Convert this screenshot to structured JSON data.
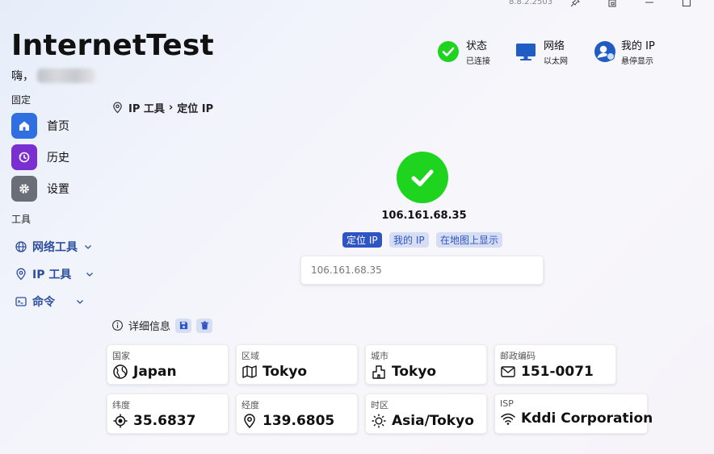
{
  "window": {
    "version": "8.8.2.2503"
  },
  "app": {
    "title": "InternetTest",
    "greeting": "嗨，"
  },
  "sidebar": {
    "pinned_label": "固定",
    "pinned": [
      {
        "label": "首页",
        "icon": "home-icon",
        "color": "#2f6fe0"
      },
      {
        "label": "历史",
        "icon": "history-icon",
        "color": "#7a2fd0"
      },
      {
        "label": "设置",
        "icon": "gear-icon",
        "color": "#6a6e76"
      }
    ],
    "tools_label": "工具",
    "tools": [
      {
        "label": "网络工具",
        "icon": "globe-icon"
      },
      {
        "label": "IP 工具",
        "icon": "location-pin-icon"
      },
      {
        "label": "命令",
        "icon": "terminal-icon"
      }
    ]
  },
  "status": {
    "state": {
      "title": "状态",
      "sub": "已连接",
      "icon": "check-circle-icon"
    },
    "network": {
      "title": "网络",
      "sub": "以太网",
      "icon": "monitor-icon"
    },
    "my_ip": {
      "title": "我的 IP",
      "sub": "悬停显示",
      "icon": "user-globe-icon"
    }
  },
  "breadcrumb": {
    "root": "IP 工具",
    "separator": "›",
    "current": "定位 IP"
  },
  "result": {
    "ip": "106.161.68.35"
  },
  "actions": {
    "locate": "定位 IP",
    "my_ip": "我的 IP",
    "map": "在地图上显示"
  },
  "input": {
    "value": "106.161.68.35"
  },
  "details": {
    "title": "详细信息",
    "cards": [
      {
        "label": "国家",
        "value": "Japan",
        "icon": "globe-icon"
      },
      {
        "label": "区域",
        "value": "Tokyo",
        "icon": "map-icon"
      },
      {
        "label": "城市",
        "value": "Tokyo",
        "icon": "city-icon"
      },
      {
        "label": "邮政编码",
        "value": "151-0071",
        "icon": "mail-icon"
      },
      {
        "label": "纬度",
        "value": "35.6837",
        "icon": "crosshair-icon"
      },
      {
        "label": "经度",
        "value": "139.6805",
        "icon": "location-pin-icon"
      },
      {
        "label": "时区",
        "value": "Asia/Tokyo",
        "icon": "sun-icon"
      },
      {
        "label": "ISP",
        "value": "Kddi Corporation",
        "icon": "wifi-icon"
      }
    ]
  },
  "colors": {
    "accent": "#2f54c4",
    "success": "#1fd41f",
    "nav_text": "#2d4f9e"
  }
}
